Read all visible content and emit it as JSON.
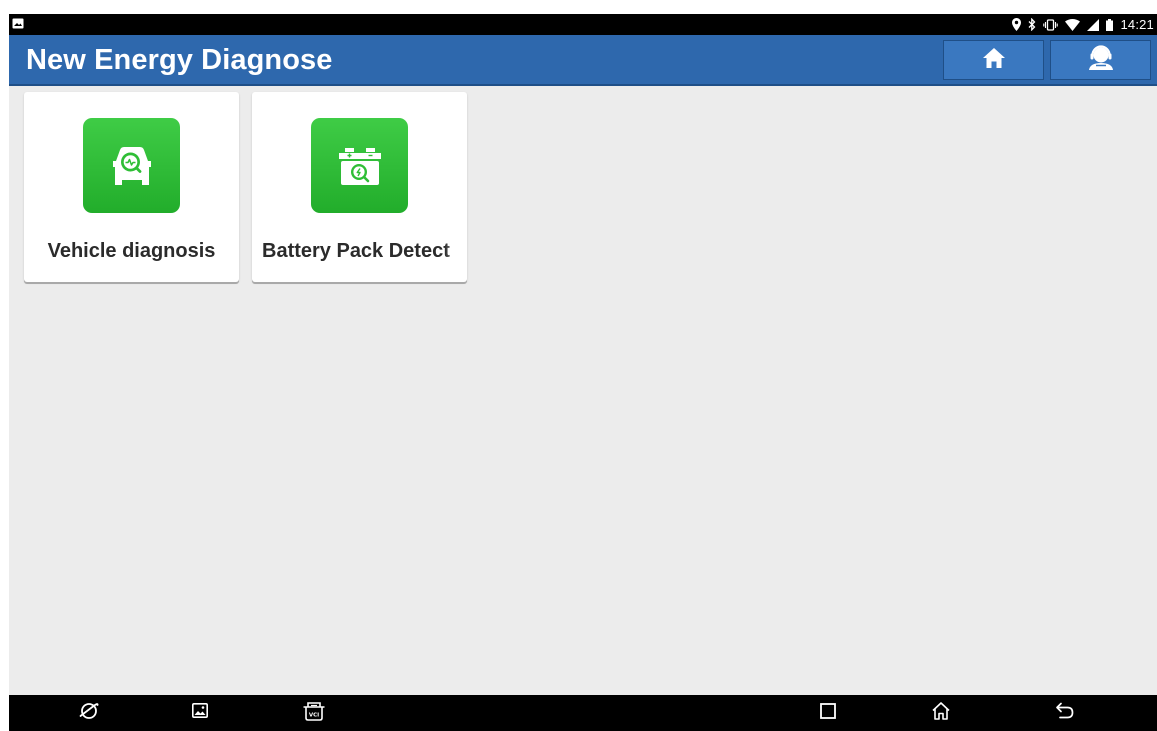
{
  "status_bar": {
    "time": "14:21",
    "icons": [
      "screenshot-icon",
      "location-icon",
      "bluetooth-icon",
      "vibrate-icon",
      "wifi-icon",
      "signal-icon",
      "battery-icon"
    ]
  },
  "header": {
    "title": "New Energy Diagnose",
    "buttons": [
      {
        "name": "home-icon"
      },
      {
        "name": "support-agent-icon"
      }
    ]
  },
  "colors": {
    "header_bg": "#2e68ad",
    "header_button_bg": "#3a78c0",
    "tile_green": "#2fbe36",
    "content_bg": "#ececec"
  },
  "tiles": [
    {
      "label": "Vehicle diagnosis",
      "icon": "vehicle-diagnosis-icon"
    },
    {
      "label": "Battery Pack Detect",
      "icon": "battery-pack-detect-icon"
    }
  ],
  "nav_bar": {
    "buttons": [
      "browser-icon",
      "gallery-icon",
      "vci-icon",
      "recents-icon",
      "home-icon",
      "back-icon"
    ]
  }
}
